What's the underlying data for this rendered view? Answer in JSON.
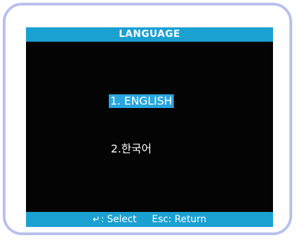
{
  "header": {
    "title": "LANGUAGE"
  },
  "menu": {
    "items": [
      {
        "label": "1. ENGLISH",
        "selected": true
      },
      {
        "label": "2.한국어",
        "selected": false
      }
    ]
  },
  "footer": {
    "select_icon": "enter-key-icon",
    "select_glyph": "↵",
    "select_label": ": Select",
    "return_label": "Esc: Return"
  },
  "colors": {
    "accent": "#1ba0d2",
    "highlight": "#29a6df",
    "screen_background": "#040404",
    "frame_border": "#b8c0ee"
  }
}
